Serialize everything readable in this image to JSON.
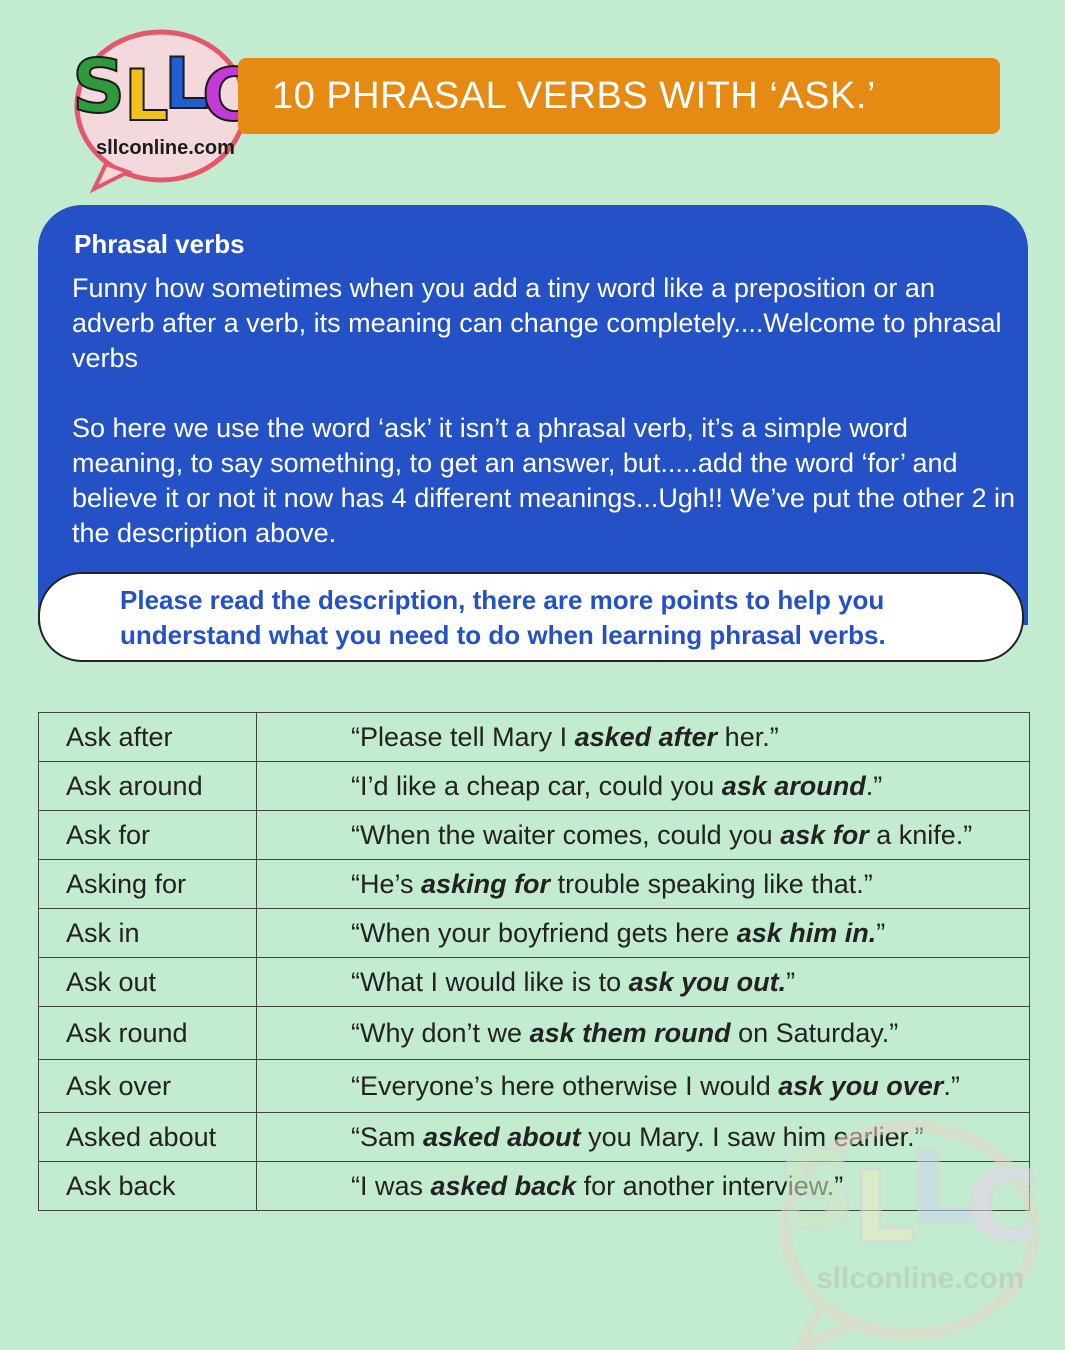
{
  "header": {
    "logo_text": "SLC",
    "logo_url_text": "sllconline.com",
    "title": "10 PHRASAL VERBS WITH ‘ASK.’"
  },
  "intro": {
    "heading": "Phrasal verbs",
    "paragraph_1": "Funny how sometimes when you add a tiny word like a preposition or an adverb after a verb, its meaning can change completely....Welcome to phrasal verbs",
    "paragraph_2": "So here we use the word ‘ask’ it isn’t a phrasal verb, it’s a simple word meaning, to say something, to get an answer, but.....add the word ‘for’ and believe it or not it now has 4 different meanings...Ugh!! We’ve put the other 2 in the description above."
  },
  "notice": {
    "text": "Please read the description, there are more points to help you understand what you need to do when learning phrasal verbs."
  },
  "rows": [
    {
      "verb": "Ask after",
      "pre": "“Please tell Mary I ",
      "bold": "asked after",
      "post": " her.”"
    },
    {
      "verb": "Ask around",
      "pre": "“I’d like a cheap car, could you ",
      "bold": "ask around",
      "post": ".”"
    },
    {
      "verb": "Ask for",
      "pre": "“When the waiter comes, could you ",
      "bold": "ask for",
      "post": " a knife.”"
    },
    {
      "verb": "Asking for",
      "pre": "“He’s ",
      "bold": "asking for",
      "post": " trouble speaking like that.”"
    },
    {
      "verb": "Ask in",
      "pre": "“When your boyfriend gets here ",
      "bold": "ask him in.",
      "post": "”"
    },
    {
      "verb": "Ask out",
      "pre": "“What I would like is to ",
      "bold": "ask you out.",
      "post": "”"
    },
    {
      "verb": "Ask round",
      "pre": "“Why don’t we ",
      "bold": "ask them round",
      "post": " on Saturday.”"
    },
    {
      "verb": "Ask over",
      "pre": "“Everyone’s here otherwise I would ",
      "bold": "ask you over",
      "post": ".”"
    },
    {
      "verb": "Asked about",
      "pre": "“Sam ",
      "bold": "asked about",
      "post": " you Mary. I saw him earlier.”"
    },
    {
      "verb": "Ask back",
      "pre": "“I was ",
      "bold": "asked back",
      "post": " for another interview.”"
    }
  ],
  "colors": {
    "background": "#c2ebd0",
    "title_bar": "#e58a13",
    "panel": "#2452c6",
    "logo_s": "#2e9a3c",
    "logo_l1": "#f2c21b",
    "logo_l2": "#1f5fd0",
    "logo_c": "#c33bd6",
    "logo_ring": "#e4576a"
  }
}
